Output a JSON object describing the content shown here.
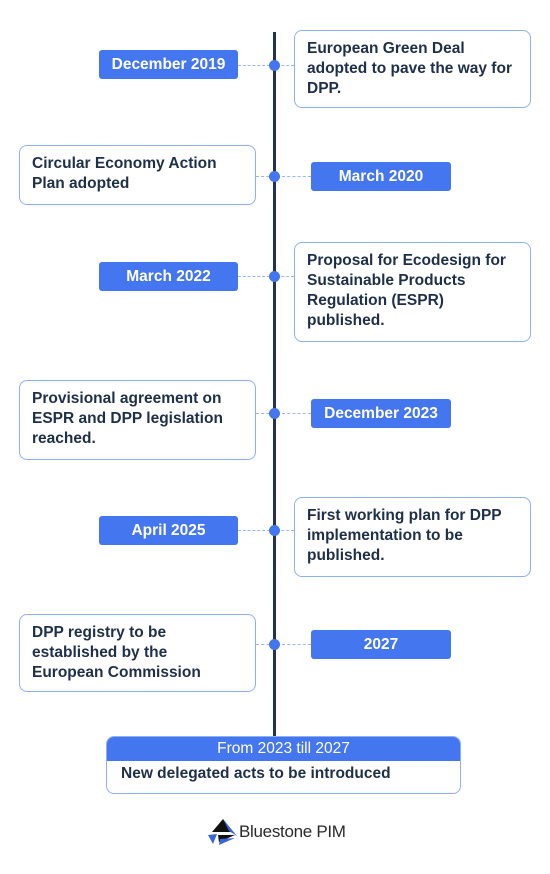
{
  "timeline": {
    "events": [
      {
        "date": "December 2019",
        "text": "European Green Deal adopted to pave the way for DPP.",
        "side": "date-left"
      },
      {
        "date": "March 2020",
        "text": "Circular Economy Action Plan adopted",
        "side": "date-right"
      },
      {
        "date": "March 2022",
        "text": "Proposal for Ecodesign for Sustainable Products Regulation (ESPR) published.",
        "side": "date-left"
      },
      {
        "date": "December 2023",
        "text": "Provisional agreement on ESPR and DPP legislation reached.",
        "side": "date-right"
      },
      {
        "date": "April 2025",
        "text": "First working plan for DPP implementation to be published.",
        "side": "date-left"
      },
      {
        "date": "2027",
        "text": "DPP registry to be established by the European Commission",
        "side": "date-right"
      }
    ],
    "final": {
      "header": "From 2023 till 2027",
      "text": "New delegated acts to be introduced"
    }
  },
  "brand": {
    "name": "Bluestone PIM",
    "accent": "#4476f0",
    "axis_color": "#22324f"
  }
}
